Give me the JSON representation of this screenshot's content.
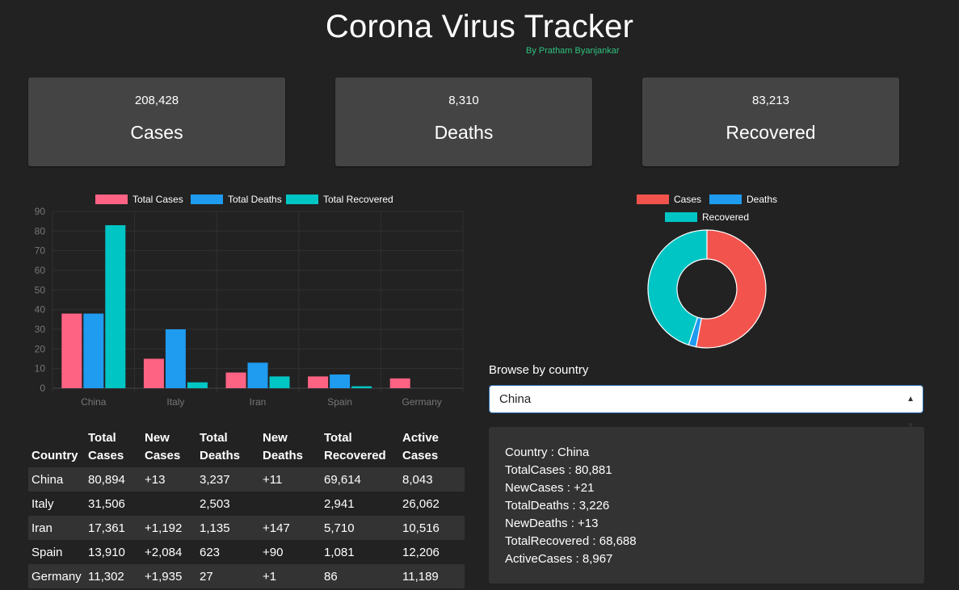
{
  "header": {
    "title": "Corona Virus Tracker",
    "subtitle": "By Pratham Byanjankar"
  },
  "summary": [
    {
      "value": "208,428",
      "label": "Cases"
    },
    {
      "value": "8,310",
      "label": "Deaths"
    },
    {
      "value": "83,213",
      "label": "Recovered"
    }
  ],
  "colors": {
    "cases_bar": "#ff6384",
    "deaths": "#1f9bf0",
    "recovered": "#00c5c5",
    "cases_pie": "#f2544d"
  },
  "chart_data": [
    {
      "type": "bar",
      "categories": [
        "China",
        "Italy",
        "Iran",
        "Spain",
        "Germany"
      ],
      "series": [
        {
          "name": "Total Cases",
          "values": [
            38,
            15,
            8,
            6,
            5
          ]
        },
        {
          "name": "Total Deaths",
          "values": [
            38,
            30,
            13,
            7,
            0
          ]
        },
        {
          "name": "Total Recovered",
          "values": [
            83,
            3,
            6,
            1,
            0
          ]
        }
      ],
      "yticks": [
        "90",
        "80",
        "70",
        "60",
        "50",
        "40",
        "30",
        "20",
        "10",
        "0"
      ],
      "ylim": [
        0,
        90
      ],
      "grid": true,
      "legend": "top"
    },
    {
      "type": "pie",
      "labels": [
        "Cases",
        "Deaths",
        "Recovered"
      ],
      "values": [
        80881,
        3226,
        68688
      ],
      "legend": "top"
    }
  ],
  "browse": {
    "label": "Browse by country",
    "selected": "China"
  },
  "detail": [
    "Country : China",
    "TotalCases : 80,881",
    "NewCases : +21",
    "TotalDeaths : 3,226",
    "NewDeaths : +13",
    "TotalRecovered : 68,688",
    "ActiveCases : 8,967"
  ],
  "table": {
    "headers": [
      [
        "Country",
        ""
      ],
      [
        "Total",
        "Cases"
      ],
      [
        "New",
        "Cases"
      ],
      [
        "Total",
        "Deaths"
      ],
      [
        "New",
        "Deaths"
      ],
      [
        "Total",
        "Recovered"
      ],
      [
        "Active",
        "Cases"
      ]
    ],
    "rows": [
      [
        "China",
        "80,894",
        "+13",
        "3,237",
        "+11",
        "69,614",
        "8,043"
      ],
      [
        "Italy",
        "31,506",
        "",
        "2,503",
        "",
        "2,941",
        "26,062"
      ],
      [
        "Iran",
        "17,361",
        "+1,192",
        "1,135",
        "+147",
        "5,710",
        "10,516"
      ],
      [
        "Spain",
        "13,910",
        "+2,084",
        "623",
        "+90",
        "1,081",
        "12,206"
      ],
      [
        "Germany",
        "11,302",
        "+1,935",
        "27",
        "+1",
        "86",
        "11,189"
      ]
    ]
  }
}
